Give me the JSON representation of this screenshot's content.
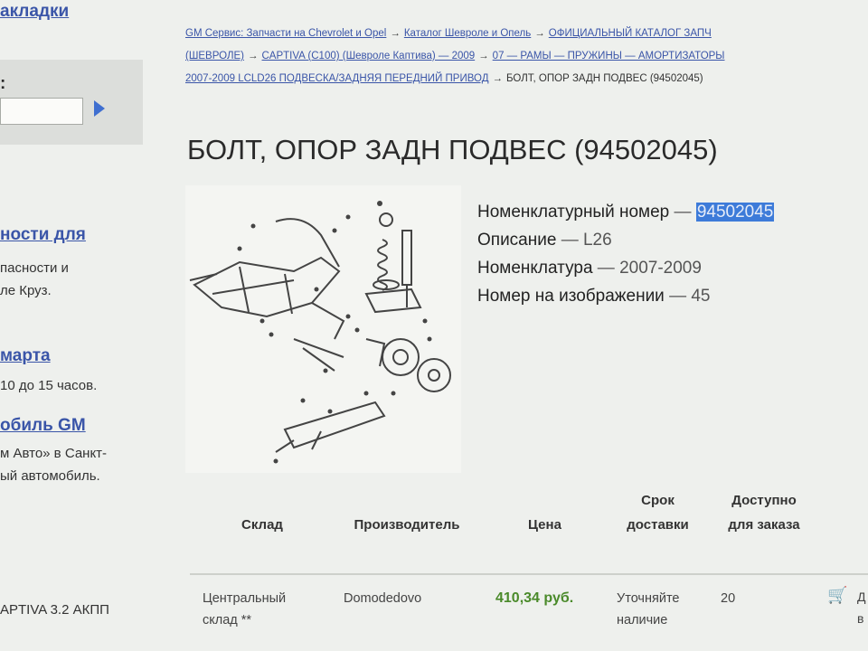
{
  "sidebar": {
    "bookmarks": "акладки",
    "search_label": ":",
    "search_value": "",
    "blocks": [
      {
        "head": "ности для",
        "lines": [
          "пасности и",
          "ле Круз."
        ]
      },
      {
        "head": "марта",
        "lines": [
          "10 до 15 часов."
        ]
      },
      {
        "head": "обиль GM",
        "lines": [
          "м Авто» в Санкт-",
          "ый автомобиль."
        ]
      }
    ],
    "bottom": "APTIVA 3.2 АКПП"
  },
  "breadcrumb": {
    "items": [
      "GM Сервис: Запчасти на Chevrolet и Opel",
      "Каталог Шевроле и Опель",
      "ОФИЦИАЛЬНЫЙ КАТАЛОГ ЗАПЧ",
      "(ШЕВРОЛЕ)",
      "CAPTIVA (C100) (Шевроле Каптива) — 2009",
      "07 — РАМЫ — ПРУЖИНЫ — АМОРТИЗАТОРЫ",
      "2007-2009 LCLD26 ПОДВЕСКА/ЗАДНЯЯ ПЕРЕДНИЙ ПРИВОД"
    ],
    "current": "БОЛТ, ОПОР ЗАДН ПОДВЕС (94502045)"
  },
  "part": {
    "title": "БОЛТ, ОПОР ЗАДН ПОДВЕС (94502045)",
    "rows": [
      {
        "label": "Номенклатурный номер",
        "value": "94502045"
      },
      {
        "label": "Описание",
        "value": "L26"
      },
      {
        "label": "Номенклатура",
        "value": "2007-2009"
      },
      {
        "label": "Номер на изображении",
        "value": "45"
      }
    ],
    "dash": " — "
  },
  "table": {
    "headers": [
      "Склад",
      "Производитель",
      "Цена",
      "Срок доставки",
      "Доступно для заказа"
    ],
    "row": {
      "warehouse": "Центральный склад **",
      "maker": "Domodedovo",
      "price": "410,34 руб.",
      "delivery": "Уточняйте наличие",
      "available": "20",
      "cart_label": "Д в"
    }
  },
  "colors": {
    "link": "#3a55a8",
    "price": "#4a8a2a",
    "highlight": "#3d7bd9"
  },
  "icons": {
    "go": "triangle-right-icon",
    "cart": "cart-icon"
  }
}
